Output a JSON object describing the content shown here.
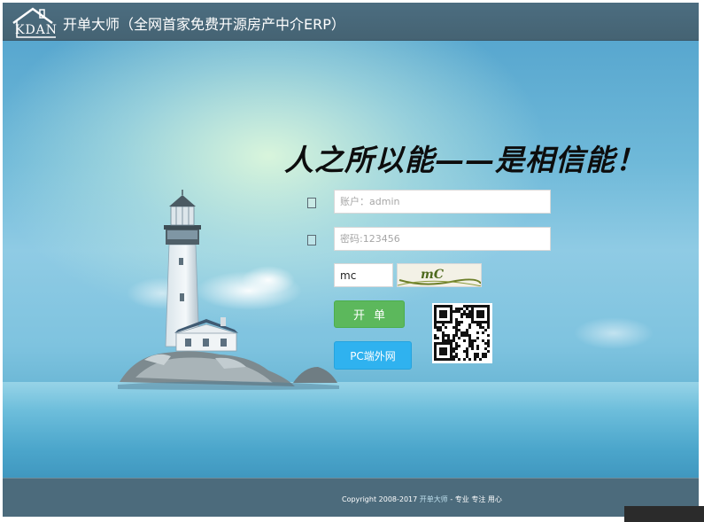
{
  "header": {
    "logo_text": "KDAN",
    "app_title": "开单大师（全网首家免费开源房产中介ERP）"
  },
  "hero": {
    "slogan": "人之所以能——是相信能！"
  },
  "login": {
    "username": {
      "icon": "user-icon",
      "placeholder": "账户：admin",
      "value": ""
    },
    "password": {
      "icon": "lock-icon",
      "placeholder": "密码:123456",
      "value": ""
    },
    "captcha": {
      "value": "mc",
      "image_text": "mC"
    },
    "login_label": "开单",
    "pc_label": "PC端外网",
    "qr_icon": "qr-code-icon"
  },
  "footer": {
    "copyright_prefix": "Copyright 2008-2017",
    "brand": "开单大师",
    "tagline": "- 专业 专注 用心"
  },
  "colors": {
    "header_bg": "#4a6a7c",
    "login_button": "#5cb85c",
    "pc_button": "#2fb2ef",
    "footer_bg": "#4c6b7c"
  }
}
